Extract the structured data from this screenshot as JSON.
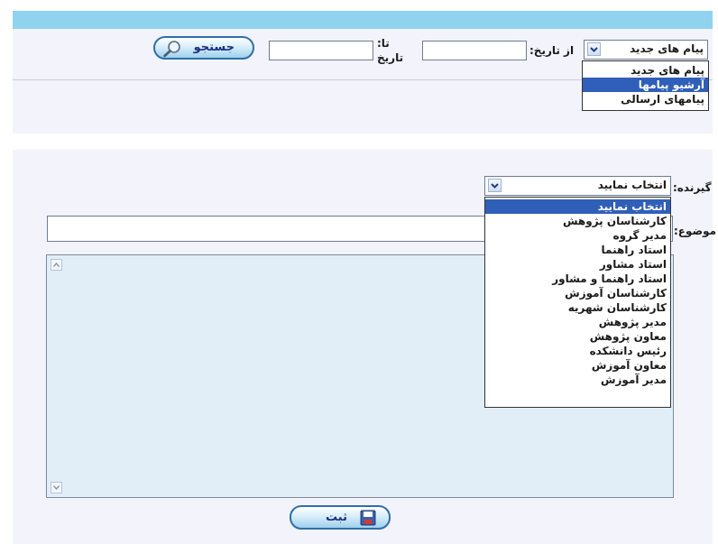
{
  "filter": {
    "message_type": {
      "selected": "پیام های جدید",
      "options": [
        "پیام های جدید",
        "آرشیو پیامها",
        "پیامهای ارسالی"
      ],
      "highlighted_index": 1
    },
    "from_date_label": "از تاریخ:",
    "from_date_value": "",
    "to_date_label_line1": "تا:",
    "to_date_label_line2": "تاریخ",
    "to_date_value": "",
    "search_button_label": "جستجو"
  },
  "compose": {
    "recipient_label": "گیرنده:",
    "recipient": {
      "selected": "انتخاب نمایید",
      "options": [
        "انتخاب نمایید",
        "کارشناسان پژوهش",
        "مدیر گروه",
        "استاد راهنما",
        "استاد مشاور",
        "استاد راهنما و مشاور",
        "کارشناسان آموزش",
        "کارشناسان شهریه",
        "مدیر پژوهش",
        "معاون پژوهش",
        "رئیس دانشکده",
        "معاون آموزش",
        "مدیر آموزش"
      ],
      "highlighted_index": 0
    },
    "subject_label": "موضوع:",
    "subject_value": "",
    "body_value": "",
    "submit_button_label": "ثبت"
  },
  "icons": {
    "search": "magnifier-icon",
    "submit": "floppy-disk-icon",
    "dropdown": "chevron-down-icon"
  },
  "colors": {
    "header_bar": "#8fd3ef",
    "panel_bg": "#f2f3fb",
    "selection": "#2f5fb8",
    "textarea_bg": "#e1eef7",
    "button_text": "#1b2f7e"
  }
}
